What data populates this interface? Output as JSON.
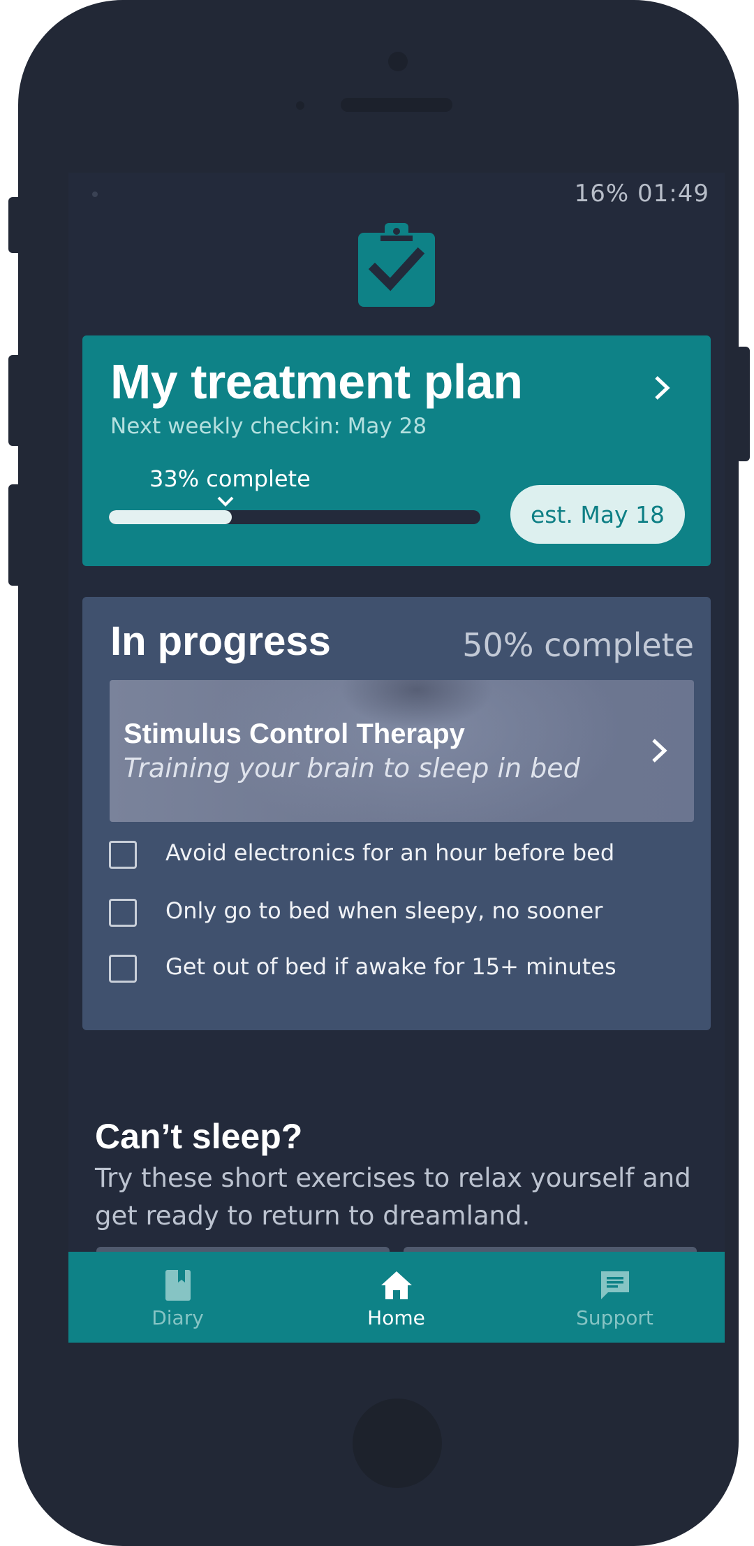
{
  "status_bar": {
    "text": "16% 01:49"
  },
  "header": {
    "logo_icon": "clipboard-check-icon"
  },
  "treatment_plan": {
    "title": "My treatment plan",
    "subtitle": "Next weekly checkin: May 28",
    "progress_label": "33% complete",
    "progress_value": 0.33,
    "estimate": "est. May 18"
  },
  "in_progress": {
    "title": "In progress",
    "percent_label": "50% complete",
    "therapy": {
      "name": "Stimulus Control Therapy",
      "description": "Training your brain to sleep in bed"
    },
    "checklist": [
      {
        "label": "Avoid electronics for an hour before bed",
        "checked": false
      },
      {
        "label": "Only go to bed when sleepy, no sooner",
        "checked": false
      },
      {
        "label": "Get out of bed if awake for 15+ minutes",
        "checked": false
      }
    ]
  },
  "cant_sleep": {
    "title": "Can’t sleep?",
    "description": "Try these short exercises to relax yourself and get ready to return to dreamland."
  },
  "bottom_nav": {
    "items": [
      {
        "label": "Diary",
        "icon": "book-icon",
        "active": false
      },
      {
        "label": "Home",
        "icon": "home-icon",
        "active": true
      },
      {
        "label": "Support",
        "icon": "chat-icon",
        "active": false
      }
    ]
  },
  "colors": {
    "background": "#232a3b",
    "teal": "#0e8287",
    "card": "#40516e",
    "pill": "#ddf0ef"
  }
}
